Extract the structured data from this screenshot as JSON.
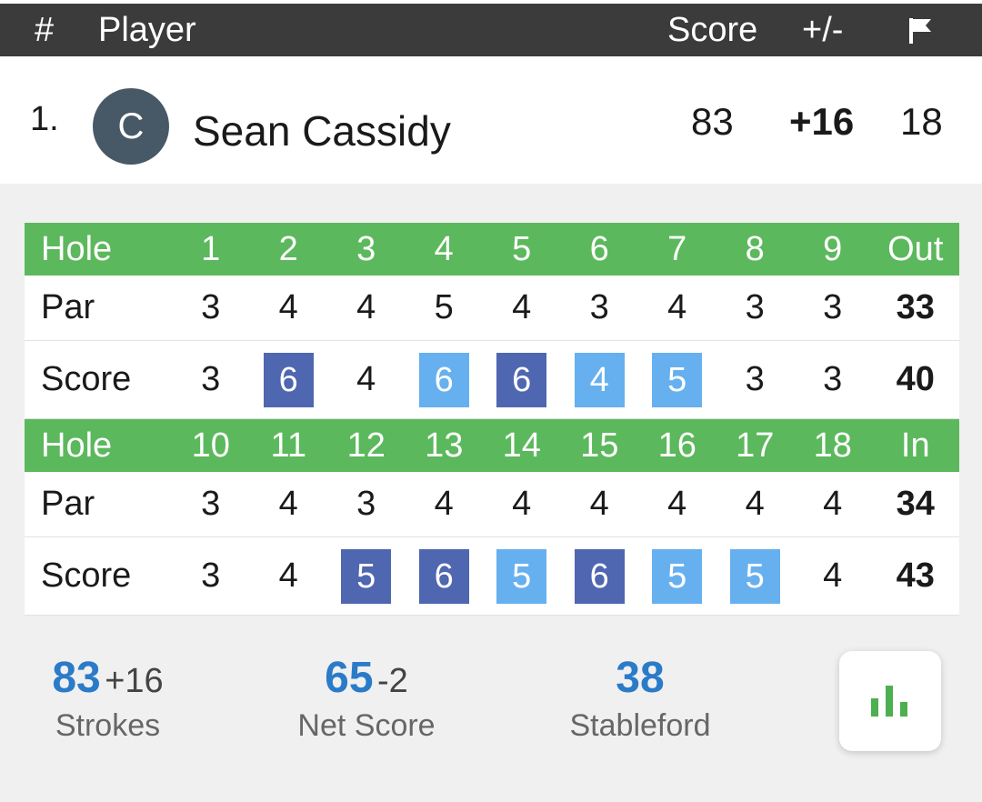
{
  "header": {
    "rank_col": "#",
    "player_col": "Player",
    "score_col": "Score",
    "diff_col": "+/-",
    "flag_icon": "flag-icon"
  },
  "player": {
    "rank": "1.",
    "initial": "C",
    "name": "Sean Cassidy",
    "score": "83",
    "diff": "+16",
    "thru": "18"
  },
  "scorecard": {
    "front": {
      "hole_label": "Hole",
      "holes": [
        "1",
        "2",
        "3",
        "4",
        "5",
        "6",
        "7",
        "8",
        "9"
      ],
      "total_label": "Out",
      "par_label": "Par",
      "pars": [
        "3",
        "4",
        "4",
        "5",
        "4",
        "3",
        "4",
        "3",
        "3"
      ],
      "par_total": "33",
      "score_label": "Score",
      "scores": [
        "3",
        "6",
        "4",
        "6",
        "6",
        "4",
        "5",
        "3",
        "3"
      ],
      "score_total": "40"
    },
    "back": {
      "hole_label": "Hole",
      "holes": [
        "10",
        "11",
        "12",
        "13",
        "14",
        "15",
        "16",
        "17",
        "18"
      ],
      "total_label": "In",
      "par_label": "Par",
      "pars": [
        "3",
        "4",
        "3",
        "4",
        "4",
        "4",
        "4",
        "4",
        "4"
      ],
      "par_total": "34",
      "score_label": "Score",
      "scores": [
        "3",
        "4",
        "5",
        "6",
        "5",
        "6",
        "5",
        "5",
        "4"
      ],
      "score_total": "43"
    },
    "colors": {
      "hole_header": "#5cb85c",
      "bogey": "#67b0ef",
      "double_bogey": "#4f66b0"
    }
  },
  "stats": {
    "strokes": {
      "value": "83",
      "diff": "+16",
      "label": "Strokes"
    },
    "net": {
      "value": "65",
      "diff": "-2",
      "label": "Net Score"
    },
    "stableford": {
      "value": "38",
      "label": "Stableford"
    },
    "chart_icon": "bar-chart-icon"
  }
}
